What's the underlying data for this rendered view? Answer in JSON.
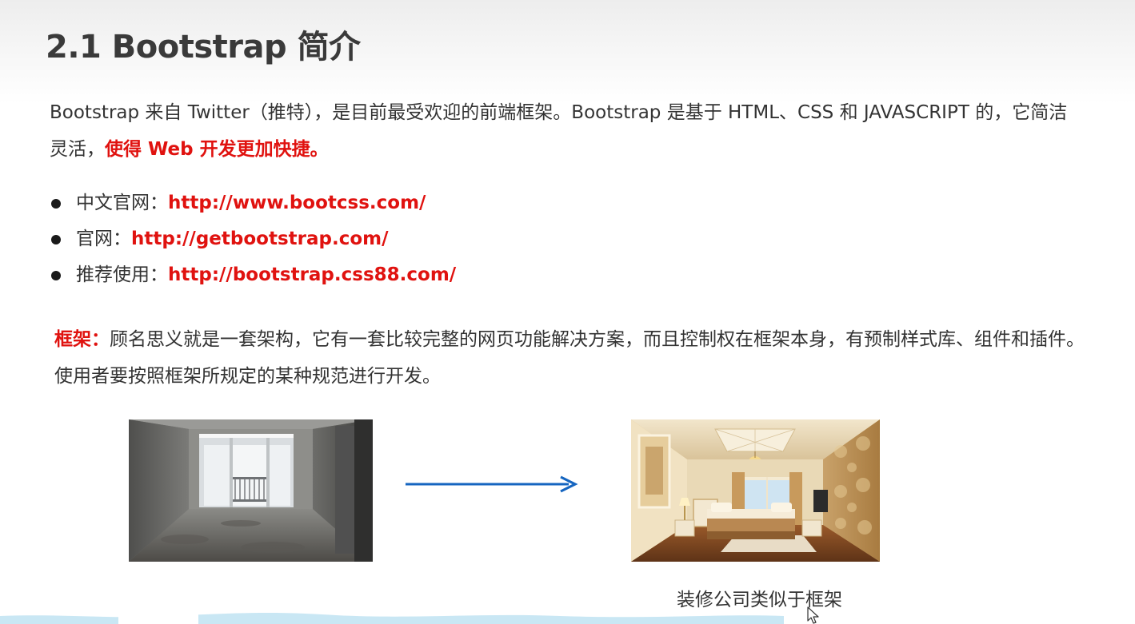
{
  "slide": {
    "title": "2.1 Bootstrap 简介",
    "intro": {
      "text": "Bootstrap 来自 Twitter（推特），是目前最受欢迎的前端框架。Bootstrap 是基于 HTML、CSS 和 JAVASCRIPT 的，它简洁灵活，",
      "highlight": "使得 Web 开发更加快捷。"
    },
    "links": [
      {
        "label": "中文官网：",
        "url": "http://www.bootcss.com/"
      },
      {
        "label": "官网：",
        "url": "http://getbootstrap.com/"
      },
      {
        "label": "推荐使用：",
        "url": "http://bootstrap.css88.com/"
      }
    ],
    "framework": {
      "term": "框架：",
      "definition": "顾名思义就是一套架构，它有一套比较完整的网页功能解决方案，而且控制权在框架本身，有预制样式库、组件和插件。使用者要按照框架所规定的某种规范进行开发。"
    },
    "images": {
      "before_icon": "unfinished-room-photo",
      "after_icon": "decorated-bedroom-photo",
      "arrow_icon": "right-arrow-icon",
      "caption": "装修公司类似于框架"
    },
    "colors": {
      "accent": "#e0120f",
      "arrow": "#1565c0",
      "text": "#333333",
      "title": "#3a3a3a"
    }
  }
}
